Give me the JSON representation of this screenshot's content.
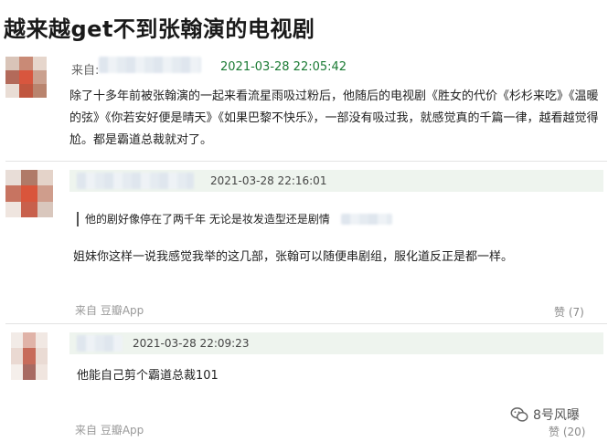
{
  "page": {
    "title": "越来越get不到张翰演的电视剧"
  },
  "main_comment": {
    "from_label": "来自:",
    "timestamp": "2021-03-28 22:05:42",
    "text": "除了十多年前被张翰演的一起来看流星雨吸过粉后，他随后的电视剧《胜女的代价《杉杉来吃》《温暖的弦》《你若安好便是晴天》《如果巴黎不快乐》，一部没有吸过我，就感觉真的千篇一律，越看越觉得尬。都是霸道总裁就对了。"
  },
  "replies": [
    {
      "timestamp": "2021-03-28 22:16:01",
      "quote": "他的剧好像停在了两千年 无论是妆发造型还是剧情",
      "text": "姐妹你这样一说我感觉我举的这几部，张翰可以随便串剧组，服化道反正是都一样。",
      "source": "来自 豆瓣App",
      "likes": "赞 (7)"
    },
    {
      "timestamp": "2021-03-28 22:09:23",
      "text": "他能自己剪个霸道总裁101",
      "source": "来自 豆瓣App",
      "likes": "赞 (20)"
    }
  ],
  "watermark": {
    "text": "8号风曝",
    "icon": "wechat-icon"
  },
  "colors": {
    "timestamp_green": "#1a7a33",
    "reply_bar": "#eef4ee",
    "muted": "#9a9a9a"
  }
}
